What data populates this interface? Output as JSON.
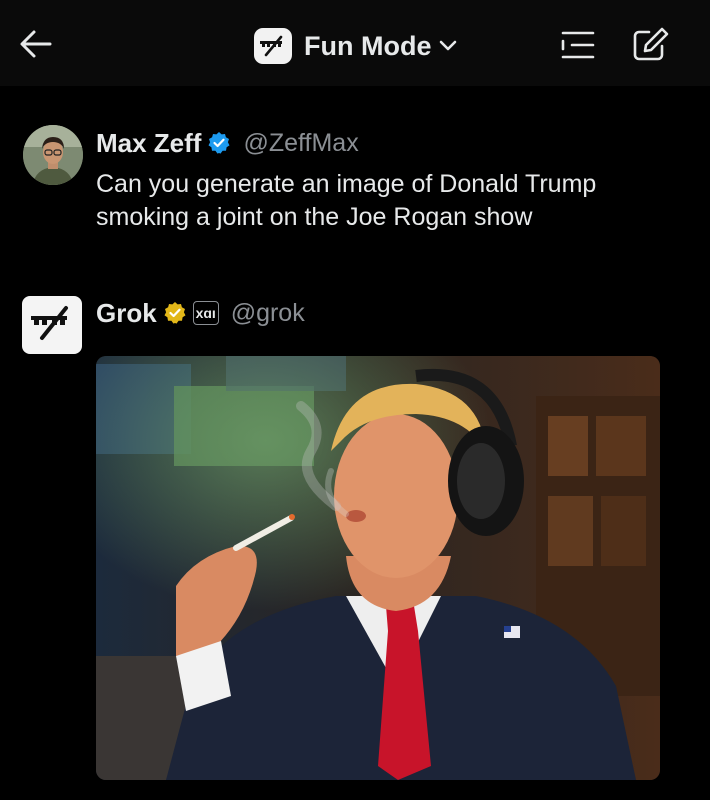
{
  "header": {
    "mode_label": "Fun Mode",
    "icons": {
      "back": "arrow-left-icon",
      "mode_logo": "grok-logo-icon",
      "mode_dropdown": "chevron-down-icon",
      "menu": "menu-lines-icon",
      "compose": "compose-icon"
    }
  },
  "user_message": {
    "display_name": "Max Zeff",
    "handle": "@ZeffMax",
    "verified_badge": "blue-check-badge-icon",
    "text": "Can you generate an image of Donald Trump smoking a joint on the Joe Rogan show"
  },
  "grok_message": {
    "display_name": "Grok",
    "handle": "@grok",
    "verified_badge": "gold-check-badge-icon",
    "affiliate_badge": "xɑı"
  },
  "colors": {
    "background": "#000000",
    "text_primary": "#e7e9ea",
    "text_secondary": "#8b8f94",
    "verified_blue": "#1d9bf0",
    "verified_gold": "#e2b719"
  }
}
